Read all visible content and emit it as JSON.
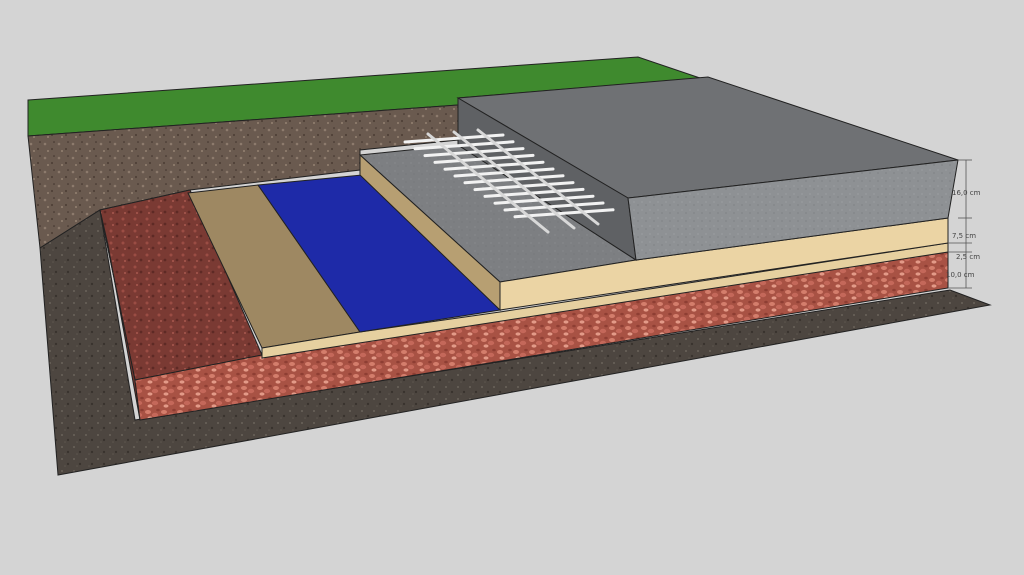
{
  "dimensions": [
    {
      "id": "top",
      "label": "16,0 cm"
    },
    {
      "id": "second",
      "label": "7,5 cm"
    },
    {
      "id": "third",
      "label": "2,5 cm"
    },
    {
      "id": "bottom",
      "label": "10,0 cm"
    }
  ],
  "colors": {
    "background": "#d4d4d4",
    "grass": "#3f8a2e",
    "soil": "#6b5a4e",
    "subsoil": "#4e4741",
    "gravel": "#b45a4a",
    "sand": "#e8d2a2",
    "membrane": "#1e2aa8",
    "concrete": "#8c8f92",
    "rebar": "#eeeeee"
  }
}
